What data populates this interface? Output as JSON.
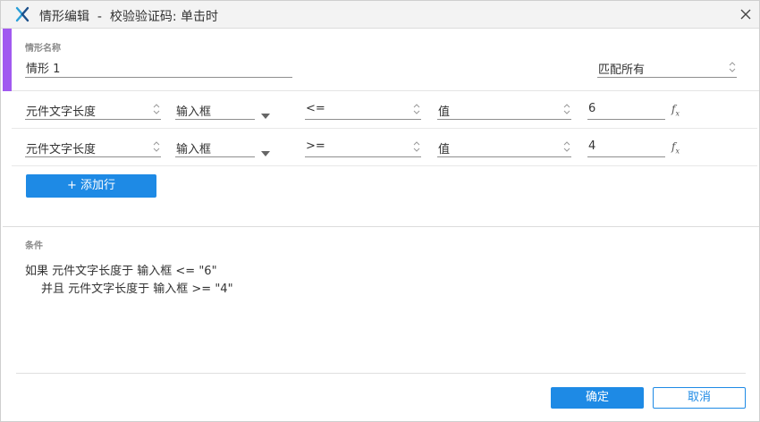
{
  "window": {
    "title": "情形编辑  -  校验验证码: 单击时",
    "logo_icon": "axure-x-icon",
    "close_icon": "close-icon"
  },
  "scenario": {
    "name_label": "情形名称",
    "name_value": "情形 1",
    "match_value": "匹配所有",
    "accent_color": "#a15af0"
  },
  "conditions": [
    {
      "target": "元件文字长度",
      "widget": "输入框",
      "operator": "<=",
      "value_type": "值",
      "value": "6",
      "fx": "f",
      "fx_sub": "x"
    },
    {
      "target": "元件文字长度",
      "widget": "输入框",
      "operator": ">=",
      "value_type": "值",
      "value": "4",
      "fx": "f",
      "fx_sub": "x"
    }
  ],
  "add_row_label": "+ 添加行",
  "summary": {
    "label": "条件",
    "line1": "如果 元件文字长度于 输入框 <= \"6\"",
    "line2": "并且 元件文字长度于 输入框 >= \"4\""
  },
  "footer": {
    "ok_label": "确定",
    "cancel_label": "取消",
    "primary_color": "#1e8ae5"
  }
}
